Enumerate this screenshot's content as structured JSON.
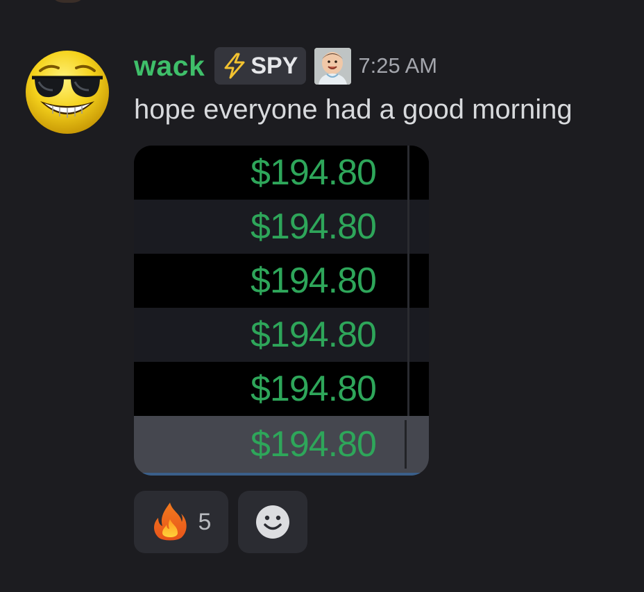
{
  "message": {
    "username": "wack",
    "tag_label": "SPY",
    "timestamp": "7:25 AM",
    "text": "hope everyone had a good morning"
  },
  "image": {
    "rows": [
      {
        "price": "$194.80"
      },
      {
        "price": "$194.80"
      },
      {
        "price": "$194.80"
      },
      {
        "price": "$194.80"
      },
      {
        "price": "$194.80"
      },
      {
        "price": "$194.80"
      }
    ]
  },
  "reactions": [
    {
      "icon": "fire-icon",
      "count": "5"
    }
  ],
  "colors": {
    "username": "#3fbf6a",
    "price": "#2ea65a",
    "background": "#1c1c20",
    "tag_bg": "#34353c",
    "lightning": "#f2c230"
  },
  "icons": {
    "avatar": "sunglasses-smiley-avatar",
    "tag": "lightning-icon",
    "role": "baby-photo-icon",
    "add_reaction": "add-reaction-smiley-icon"
  }
}
